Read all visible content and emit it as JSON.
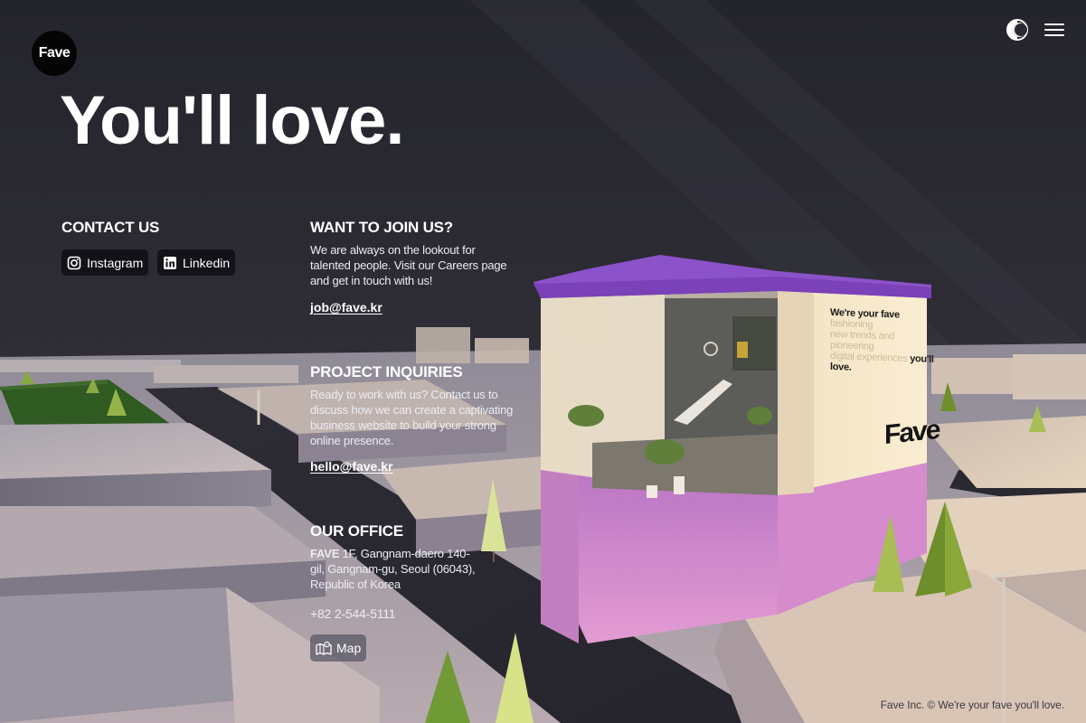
{
  "brand": {
    "logo_text": "Fave"
  },
  "header": {
    "theme_toggle_icon": "contrast-icon",
    "menu_icon": "hamburger-menu-icon"
  },
  "hero": {
    "title": "You'll love."
  },
  "contact": {
    "title": "CONTACT US",
    "instagram_label": "Instagram",
    "linkedin_label": "Linkedin"
  },
  "join": {
    "title": "WANT TO JOIN US?",
    "line1": "We are always on the lookout for",
    "line2": "talented people. Visit our Careers page",
    "line3": "and get in touch with us!",
    "email": "job@fave.kr"
  },
  "inquiries": {
    "title": "PROJECT INQUIRIES",
    "line1": "Ready to work with us? Contact us to",
    "line2": "discuss how we can create a captivating",
    "line3": "business website to build your strong",
    "line4": "online presence.",
    "email": "hello@fave.kr"
  },
  "office": {
    "title": "OUR OFFICE",
    "company": "FAVE",
    "address_line1": " 1F, Gangnam-daero 140-",
    "address_line2": "gil, Gangnam-gu, Seoul (06043),",
    "address_line3": "Republic of Korea",
    "phone": "+82 2-544-5111",
    "map_label": "Map"
  },
  "building": {
    "sign_bold_1": "We're your fave",
    "sign_light_1": "fashioning",
    "sign_light_2": "new trends and pioneering",
    "sign_light_3": "digital experiences",
    "sign_bold_2": "you'll",
    "sign_bold_3": "love.",
    "sign_logo": "Fave"
  },
  "footer": {
    "text": "Fave Inc. © We're your fave you'll love."
  },
  "colors": {
    "sky": "#2c2c34",
    "roof": "#8a4fc8",
    "base": "#d98ad0",
    "sign_wall": "#f3e4c2",
    "tree_dark": "#6f8f2a",
    "tree_light": "#d7e28a"
  }
}
